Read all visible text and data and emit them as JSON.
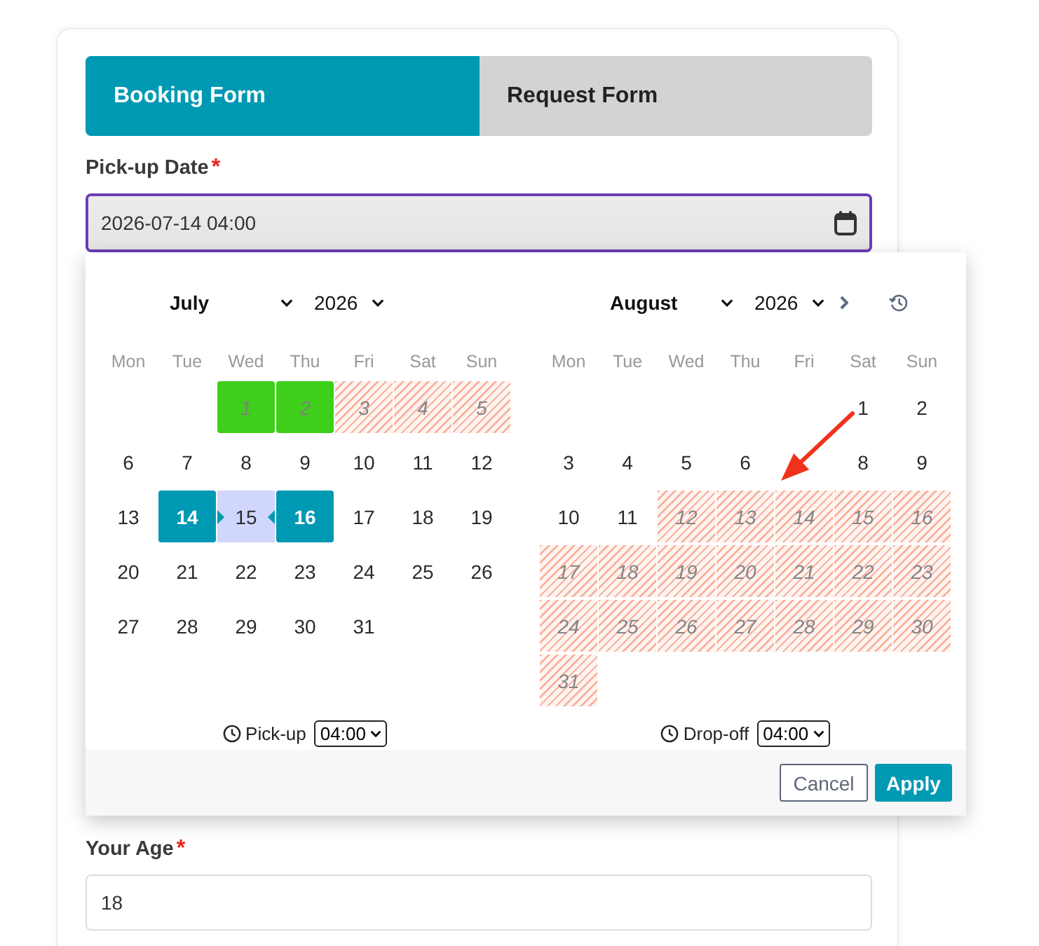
{
  "tabs": [
    {
      "label": "Booking Form",
      "selected": true
    },
    {
      "label": "Request Form",
      "selected": false
    }
  ],
  "fields": [
    {
      "label": "Pick-up Date",
      "required_mark": "*",
      "value": "2026-07-14 04:00",
      "focused": true,
      "date_picker": {
        "calendars": [
          {
            "month": "July",
            "year": "2026",
            "weekdays": [
              "Mon",
              "Tue",
              "Wed",
              "Thu",
              "Fri",
              "Sat",
              "Sun"
            ],
            "weeks": [
              {
                "kind": "first",
                "days": [
                  {
                    "day": "1",
                    "kind": "booked",
                    "selected": false
                  },
                  {
                    "day": "2",
                    "kind": "booked",
                    "selected": false
                  },
                  {
                    "day": "3",
                    "kind": "blocked",
                    "selected": false
                  },
                  {
                    "day": "4",
                    "kind": "blocked",
                    "selected": false
                  },
                  {
                    "day": "5",
                    "kind": "blocked",
                    "selected": false
                  }
                ]
              },
              {
                "kind": "full",
                "days": [
                  {
                    "day": "6",
                    "kind": "open",
                    "selected": false
                  },
                  {
                    "day": "7",
                    "kind": "open",
                    "selected": false
                  },
                  {
                    "day": "8",
                    "kind": "open",
                    "selected": false
                  },
                  {
                    "day": "9",
                    "kind": "open",
                    "selected": false
                  },
                  {
                    "day": "10",
                    "kind": "open",
                    "selected": false
                  },
                  {
                    "day": "11",
                    "kind": "open",
                    "selected": false
                  },
                  {
                    "day": "12",
                    "kind": "open",
                    "selected": false
                  }
                ]
              },
              {
                "kind": "full",
                "days": [
                  {
                    "day": "13",
                    "kind": "open",
                    "selected": false
                  },
                  {
                    "day": "14",
                    "kind": "open",
                    "selected": true
                  },
                  {
                    "day": "15",
                    "kind": "in-range",
                    "selected": false
                  },
                  {
                    "day": "16",
                    "kind": "open",
                    "selected": true
                  },
                  {
                    "day": "17",
                    "kind": "open",
                    "selected": false
                  },
                  {
                    "day": "18",
                    "kind": "open",
                    "selected": false
                  },
                  {
                    "day": "19",
                    "kind": "open",
                    "selected": false
                  }
                ]
              },
              {
                "kind": "full",
                "days": [
                  {
                    "day": "20",
                    "kind": "open",
                    "selected": false
                  },
                  {
                    "day": "21",
                    "kind": "open",
                    "selected": false
                  },
                  {
                    "day": "22",
                    "kind": "open",
                    "selected": false
                  },
                  {
                    "day": "23",
                    "kind": "open",
                    "selected": false
                  },
                  {
                    "day": "24",
                    "kind": "open",
                    "selected": false
                  },
                  {
                    "day": "25",
                    "kind": "open",
                    "selected": false
                  },
                  {
                    "day": "26",
                    "kind": "open",
                    "selected": false
                  }
                ]
              },
              {
                "kind": "full",
                "days": [
                  {
                    "day": "27",
                    "kind": "open",
                    "selected": false
                  },
                  {
                    "day": "28",
                    "kind": "open",
                    "selected": false
                  },
                  {
                    "day": "29",
                    "kind": "open",
                    "selected": false
                  },
                  {
                    "day": "30",
                    "kind": "open",
                    "selected": false
                  },
                  {
                    "day": "31",
                    "kind": "open",
                    "selected": false
                  }
                ]
              }
            ],
            "time": {
              "label": "Pick-up",
              "value": "04:00"
            }
          },
          {
            "month": "August",
            "year": "2026",
            "weekdays": [
              "Mon",
              "Tue",
              "Wed",
              "Thu",
              "Fri",
              "Sat",
              "Sun"
            ],
            "weeks": [
              {
                "kind": "first",
                "days": [
                  {
                    "day": "1",
                    "kind": "open",
                    "selected": false
                  },
                  {
                    "day": "2",
                    "kind": "open",
                    "selected": false
                  }
                ]
              },
              {
                "kind": "full",
                "days": [
                  {
                    "day": "3",
                    "kind": "open",
                    "selected": false
                  },
                  {
                    "day": "4",
                    "kind": "open",
                    "selected": false
                  },
                  {
                    "day": "5",
                    "kind": "open",
                    "selected": false
                  },
                  {
                    "day": "6",
                    "kind": "open",
                    "selected": false
                  },
                  {
                    "kind": "open",
                    "selected": false
                  },
                  {
                    "day": "8",
                    "kind": "open",
                    "selected": false
                  },
                  {
                    "day": "9",
                    "kind": "open",
                    "selected": false
                  }
                ]
              },
              {
                "kind": "full",
                "days": [
                  {
                    "day": "10",
                    "kind": "open",
                    "selected": false
                  },
                  {
                    "day": "11",
                    "kind": "open",
                    "selected": false
                  },
                  {
                    "day": "12",
                    "kind": "blocked",
                    "selected": false
                  },
                  {
                    "day": "13",
                    "kind": "blocked",
                    "selected": false
                  },
                  {
                    "day": "14",
                    "kind": "blocked",
                    "selected": false
                  },
                  {
                    "day": "15",
                    "kind": "blocked",
                    "selected": false
                  },
                  {
                    "day": "16",
                    "kind": "blocked",
                    "selected": false
                  }
                ]
              },
              {
                "kind": "full",
                "days": [
                  {
                    "day": "17",
                    "kind": "blocked",
                    "selected": false
                  },
                  {
                    "day": "18",
                    "kind": "blocked",
                    "selected": false
                  },
                  {
                    "day": "19",
                    "kind": "blocked",
                    "selected": false
                  },
                  {
                    "day": "20",
                    "kind": "blocked",
                    "selected": false
                  },
                  {
                    "day": "21",
                    "kind": "blocked",
                    "selected": false
                  },
                  {
                    "day": "22",
                    "kind": "blocked",
                    "selected": false
                  },
                  {
                    "day": "23",
                    "kind": "blocked",
                    "selected": false
                  }
                ]
              },
              {
                "kind": "full",
                "days": [
                  {
                    "day": "24",
                    "kind": "blocked",
                    "selected": false
                  },
                  {
                    "day": "25",
                    "kind": "blocked",
                    "selected": false
                  },
                  {
                    "day": "26",
                    "kind": "blocked",
                    "selected": false
                  },
                  {
                    "day": "27",
                    "kind": "blocked",
                    "selected": false
                  },
                  {
                    "day": "28",
                    "kind": "blocked",
                    "selected": false
                  },
                  {
                    "day": "29",
                    "kind": "blocked",
                    "selected": false
                  },
                  {
                    "day": "30",
                    "kind": "blocked",
                    "selected": false
                  }
                ]
              },
              {
                "kind": "full",
                "days": [
                  {
                    "day": "31",
                    "kind": "blocked",
                    "selected": false
                  }
                ]
              }
            ],
            "time": {
              "label": "Drop-off",
              "value": "04:00"
            }
          }
        ],
        "buttons": [
          {
            "label": "Cancel",
            "kind": "secondary"
          },
          {
            "label": "Apply",
            "kind": "primary"
          }
        ]
      }
    },
    {
      "label": "Your Age",
      "required_mark": "*",
      "value": "18",
      "focused": false
    }
  ]
}
